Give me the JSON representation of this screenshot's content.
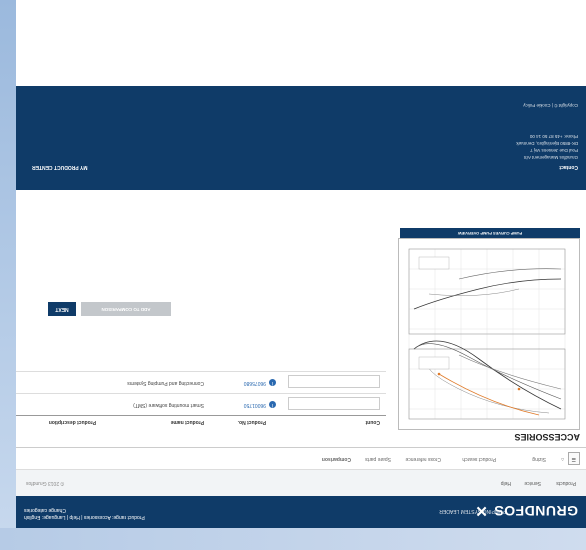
{
  "header": {
    "logo": "GRUNDFOS",
    "tagline": "PUMPING SYSTEM LEADER",
    "links": [
      "Product range: Accessories",
      "Help",
      "Language: English"
    ],
    "sub_link": "Change categories"
  },
  "topnav": {
    "items": [
      "Products",
      "Service",
      "Help"
    ],
    "copyright": "© 2013 Grundfos"
  },
  "toolbar": {
    "items": [
      "Sizing",
      "Product search",
      "Cross reference",
      "Spare parts",
      "Comparison"
    ]
  },
  "section_title": "ACCESSORIES",
  "chart": {
    "header_label": "PUMP CURVES PUMP OVERVIEW",
    "accent_color": "#e07b2a"
  },
  "table": {
    "columns": [
      "Count",
      "Product No.",
      "Product name",
      "Product description"
    ],
    "rows": [
      {
        "product_no": "96001750",
        "description": "Smart mounting software (SMT)"
      },
      {
        "product_no": "96075680",
        "description": "Connecting and Pumping Systems"
      }
    ]
  },
  "buttons": {
    "add_to_comparison": "ADD TO COMPARISON",
    "next": "NEXT"
  },
  "footer": {
    "title": "Contact",
    "lines": [
      "Grundfos Management A/S",
      "Poul Due Jensens Vej 7",
      "DK-8850 Bjerringbro, Denmark",
      "Phone: +45 87 50 14 00"
    ],
    "bottom_line": "Copyright ©  |  Cookie Policy",
    "right_label": "MY PRODUCT CENTER"
  }
}
